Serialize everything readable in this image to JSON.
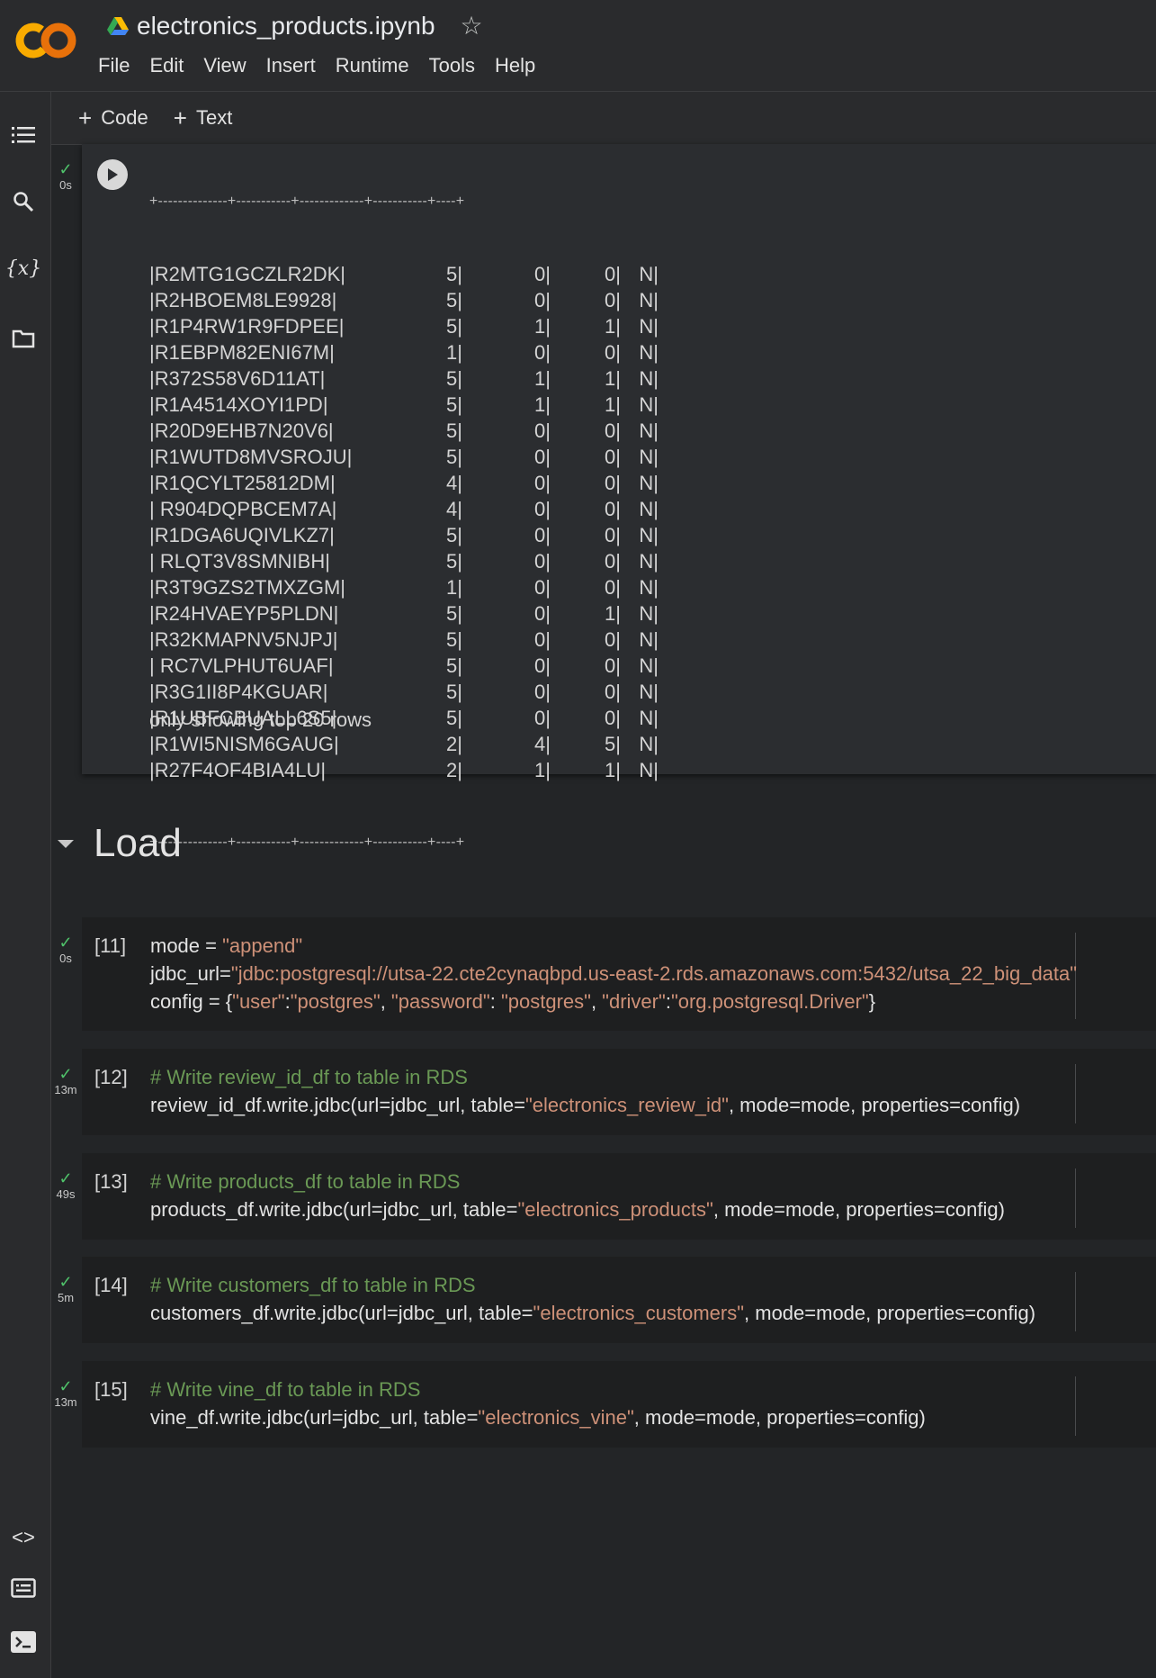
{
  "header": {
    "notebook_title": "electronics_products.ipynb",
    "menu": [
      "File",
      "Edit",
      "View",
      "Insert",
      "Runtime",
      "Tools",
      "Help"
    ]
  },
  "toolbar": {
    "code_label": "Code",
    "text_label": "Text"
  },
  "output_cell": {
    "status_time": "0s",
    "separator": "+--------------+-----------+-------------+-----------+----+",
    "rows": [
      [
        "|R2MTG1GCZLR2DK|",
        "5|",
        "0|",
        "0|",
        "N|"
      ],
      [
        "|R2HBOEM8LE9928|",
        "5|",
        "0|",
        "0|",
        "N|"
      ],
      [
        "|R1P4RW1R9FDPEE|",
        "5|",
        "1|",
        "1|",
        "N|"
      ],
      [
        "|R1EBPM82ENI67M|",
        "1|",
        "0|",
        "0|",
        "N|"
      ],
      [
        "|R372S58V6D11AT|",
        "5|",
        "1|",
        "1|",
        "N|"
      ],
      [
        "|R1A4514XOYI1PD|",
        "5|",
        "1|",
        "1|",
        "N|"
      ],
      [
        "|R20D9EHB7N20V6|",
        "5|",
        "0|",
        "0|",
        "N|"
      ],
      [
        "|R1WUTD8MVSROJU|",
        "5|",
        "0|",
        "0|",
        "N|"
      ],
      [
        "|R1QCYLT25812DM|",
        "4|",
        "0|",
        "0|",
        "N|"
      ],
      [
        "| R904DQPBCEM7A|",
        "4|",
        "0|",
        "0|",
        "N|"
      ],
      [
        "|R1DGA6UQIVLKZ7|",
        "5|",
        "0|",
        "0|",
        "N|"
      ],
      [
        "| RLQT3V8SMNIBH|",
        "5|",
        "0|",
        "0|",
        "N|"
      ],
      [
        "|R3T9GZS2TMXZGM|",
        "1|",
        "0|",
        "0|",
        "N|"
      ],
      [
        "|R24HVAEYP5PLDN|",
        "5|",
        "0|",
        "1|",
        "N|"
      ],
      [
        "|R32KMAPNV5NJPJ|",
        "5|",
        "0|",
        "0|",
        "N|"
      ],
      [
        "| RC7VLPHUT6UAF|",
        "5|",
        "0|",
        "0|",
        "N|"
      ],
      [
        "|R3G1II8P4KGUAR|",
        "5|",
        "0|",
        "0|",
        "N|"
      ],
      [
        "|R1UBFCBUALL6S5|",
        "5|",
        "0|",
        "0|",
        "N|"
      ],
      [
        "|R1WI5NISM6GAUG|",
        "2|",
        "4|",
        "5|",
        "N|"
      ],
      [
        "|R27F4OF4BIA4LU|",
        "2|",
        "1|",
        "1|",
        "N|"
      ]
    ],
    "footer": "only showing top 20 rows"
  },
  "section": {
    "title": "Load"
  },
  "cells": [
    {
      "exec": "[11]",
      "time": "0s",
      "lines": [
        [
          [
            "",
            "mode = "
          ],
          [
            "str",
            "\"append\""
          ]
        ],
        [
          [
            "",
            "jdbc_url="
          ],
          [
            "str",
            "\"jdbc:postgresql://utsa-22.cte2cynaqbpd.us-east-2.rds.amazonaws.com:5432/utsa_22_big_data\""
          ]
        ],
        [
          [
            "",
            "config = {"
          ],
          [
            "str",
            "\"user\""
          ],
          [
            "",
            ":"
          ],
          [
            "str",
            "\"postgres\""
          ],
          [
            "",
            ", "
          ],
          [
            "str",
            "\"password\""
          ],
          [
            "",
            ": "
          ],
          [
            "str",
            "\"postgres\""
          ],
          [
            "",
            ", "
          ],
          [
            "str",
            "\"driver\""
          ],
          [
            "",
            ":"
          ],
          [
            "str",
            "\"org.postgresql.Driver\""
          ],
          [
            "",
            "}"
          ]
        ]
      ]
    },
    {
      "exec": "[12]",
      "time": "13m",
      "lines": [
        [
          [
            "cm",
            "# Write review_id_df to table in RDS"
          ]
        ],
        [
          [
            "",
            "review_id_df.write.jdbc(url=jdbc_url, table="
          ],
          [
            "str",
            "\"electronics_review_id\""
          ],
          [
            "",
            ", mode=mode, properties=config)"
          ]
        ]
      ]
    },
    {
      "exec": "[13]",
      "time": "49s",
      "lines": [
        [
          [
            "cm",
            "# Write products_df to table in RDS"
          ]
        ],
        [
          [
            "",
            "products_df.write.jdbc(url=jdbc_url, table="
          ],
          [
            "str",
            "\"electronics_products\""
          ],
          [
            "",
            ", mode=mode, properties=config)"
          ]
        ]
      ]
    },
    {
      "exec": "[14]",
      "time": "5m",
      "lines": [
        [
          [
            "cm",
            "# Write customers_df to table in RDS"
          ]
        ],
        [
          [
            "",
            "customers_df.write.jdbc(url=jdbc_url, table="
          ],
          [
            "str",
            "\"electronics_customers\""
          ],
          [
            "",
            ", mode=mode, properties=config)"
          ]
        ]
      ]
    },
    {
      "exec": "[15]",
      "time": "13m",
      "lines": [
        [
          [
            "cm",
            "# Write vine_df to table in RDS"
          ]
        ],
        [
          [
            "",
            "vine_df.write.jdbc(url=jdbc_url, table="
          ],
          [
            "str",
            "\"electronics_vine\""
          ],
          [
            "",
            ", mode=mode, properties=config)"
          ]
        ]
      ]
    }
  ]
}
